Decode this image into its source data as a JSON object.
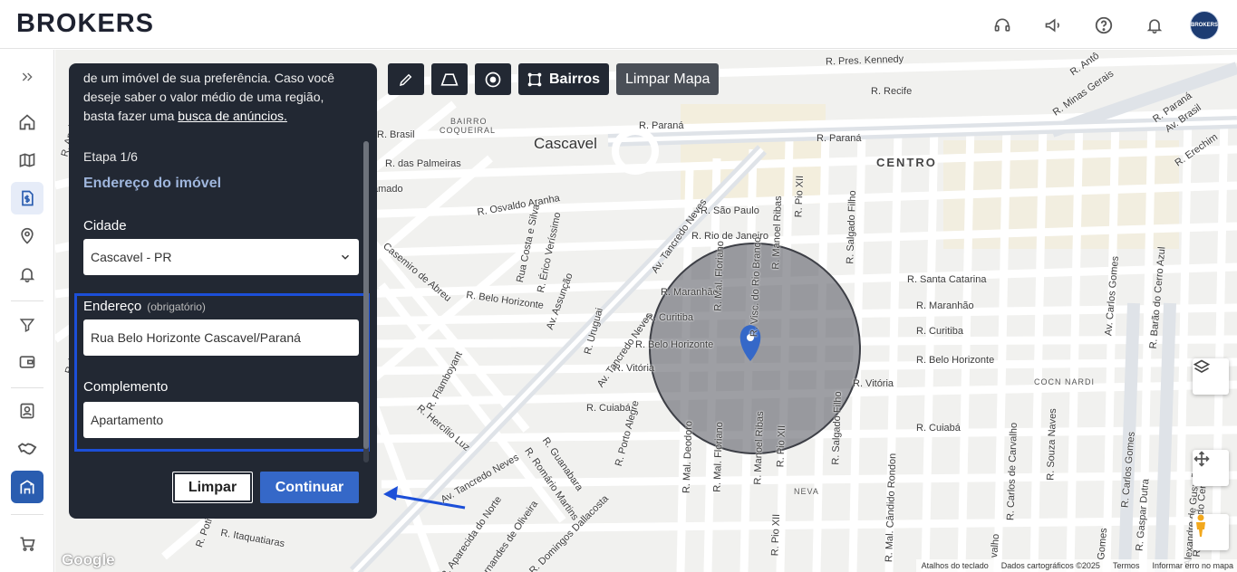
{
  "brand": {
    "logo_text": "BROKERS",
    "avatar_text": "BROKERS"
  },
  "header_icons": [
    "support-icon",
    "megaphone-icon",
    "help-icon",
    "bell-icon"
  ],
  "sidebar": {
    "items": [
      "expand-icon",
      "home-icon",
      "map-icon",
      "document-dollar-icon",
      "location-person-icon",
      "bell-icon",
      "filter-icon",
      "wallet-icon",
      "contact-card-icon",
      "handshake-icon",
      "building-evaluate-icon",
      "cart-icon"
    ]
  },
  "toolbar": {
    "bairros_label": "Bairros",
    "limpar_mapa_label": "Limpar Mapa"
  },
  "panel": {
    "intro_line1": "de um imóvel de sua preferência. Caso você",
    "intro_line2": "deseje saber o valor médio de uma região,",
    "intro_line3_prefix": "basta fazer uma ",
    "intro_link": "busca de anúncios.",
    "step": "Etapa 1/6",
    "section_title": "Endereço do imóvel",
    "city_label": "Cidade",
    "city_value": "Cascavel - PR",
    "address_label": "Endereço",
    "address_optional": "(obrigatório)",
    "address_value": "Rua Belo Horizonte  Cascavel/Paraná",
    "complement_label": "Complemento",
    "complement_value": "Apartamento",
    "clear_button": "Limpar",
    "continue_button": "Continuar"
  },
  "map": {
    "labels": {
      "cascavel": "Cascavel",
      "centro": "CENTRO",
      "bairro": "BAIRRO",
      "coqueiral": "COQUEIRAL",
      "neva": "NEVA",
      "coqueiral_l": "COCN NARDI",
      "kennedy": "R. Pres. Kennedy",
      "recife": "R. Recife",
      "parana1": "R. Paraná",
      "parana2": "R. Paraná",
      "brasil": "R. Brasil",
      "palmeiras": "R. das Palmeiras",
      "amado": "amado",
      "osvaldo": "R. Osvaldo Aranha",
      "sao_paulo": "R. São Paulo",
      "rio_janeiro": "R. Rio de Janeiro",
      "maranhao1": "R. Maranhão",
      "maranhao2": "R. Maranhão",
      "curitiba1": "R. Curitiba",
      "curitiba2": "R. Curitiba",
      "belo1": "R. Belo Horizonte",
      "belo2": "R. Belo Horizonte",
      "belo3": "R. Belo Horizonte",
      "vitoria1": "R. Vitória",
      "vitoria2": "R. Vitória",
      "cuiaba1": "R. Cuiabá",
      "cuiaba2": "R. Cuiabá",
      "santa_catarina": "R. Santa Catarina",
      "tancredo1": "Av. Tancredo Neves",
      "tancredo2": "Av. Tancredo Neves",
      "tancredo3": "Av. Tancredo Neves",
      "casemiro": "Casemiro de Abreu",
      "brasil_av": "Av. Brasil",
      "minas": "R. Minas Gerais",
      "erechim": "R. Erechim",
      "antonio": "R. Antô",
      "manoel1": "R. Manoel Ribas",
      "manoel2": "R. Manoel Ribas",
      "pio1": "R. Pio XII",
      "pio2": "R. Pio XII",
      "pio3": "R. Pio XII",
      "salgado1": "R. Salgado Filho",
      "salgado2": "R. Salgado Filho",
      "carlos_gomes1": "Av. Carlos Gomes",
      "carlos_gomes2": "R. Carlos Gomes",
      "barao": "R. Barão do Cerro Azul",
      "barao2": "R. Barão do Cerro Azul",
      "souza": "R. Souza Naves",
      "carlos_carvalho": "R. Carlos de Carvalho",
      "candido": "R. Mal. Cândido Rondon",
      "deodoro": "R. Mal. Deodoro",
      "floriano1": "R. Mal. Floriano",
      "floriano2": "R. Mal. Floriano",
      "rio_branco": "R. Visc. do Rio Branco",
      "porto_alegre": "R. Porto Alegre",
      "uruguai": "R. Uruguai",
      "assuncao": "Av. Assunção",
      "rua_costa": "Rua Costa e Silva",
      "erico": "R. Érico Veríssimo",
      "flamboyant": "R. Flamboyant",
      "hercilio": "R. Hercílio Luz",
      "guanabara": "R. Guanabara",
      "romario": "R. Romário Martins",
      "aparecida": "R. Aparecida do Norte",
      "fernandes": "Fernandes de Oliveira",
      "domingos": "R. Domingos Dallacosta",
      "itaquatiaras": "R. Itaquatiaras",
      "potig": "R. Poti",
      "apalais": "R. Apalais",
      "kamai": "R. Kamai",
      "gaspar": "R. Gaspar Dutra",
      "alexandre": "Alexandre de Gusmão",
      "gomes_s": "Gomes",
      "valho": "valho"
    },
    "attribution": [
      "Atalhos do teclado",
      "Dados cartográficos ©2025",
      "Termos",
      "Informar erro no mapa"
    ],
    "google": "Google"
  }
}
